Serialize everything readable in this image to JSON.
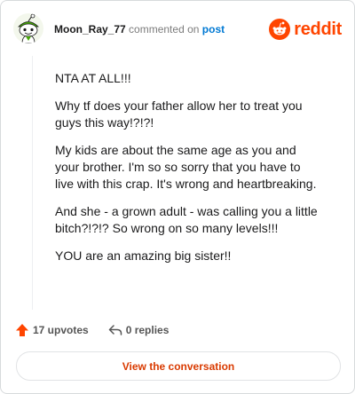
{
  "header": {
    "username": "Moon_Ray_77",
    "action_text": "commented on",
    "post_link": "post",
    "brand": "reddit"
  },
  "comment": {
    "paragraphs": [
      "NTA AT ALL!!!",
      "Why tf does your father allow her to treat you guys this way!?!?!",
      "My kids are about the same age as you and your brother. I'm so so sorry that you have to live with this crap. It's wrong and heartbreaking.",
      "And she - a grown adult - was calling you a little bitch?!?!? So wrong on so many levels!!!",
      "YOU are an amazing big sister!!"
    ]
  },
  "actions": {
    "upvotes": "17 upvotes",
    "replies": "0 replies"
  },
  "view_button": "View the conversation",
  "colors": {
    "brand": "#ff4500",
    "link": "#0079d3",
    "upvote": "#ff4500",
    "button_text": "#d93a00"
  },
  "icons": {
    "avatar": "snoo-avatar-icon",
    "brand": "reddit-logo-icon",
    "upvote": "upvote-arrow-icon",
    "reply": "reply-arrow-icon"
  }
}
